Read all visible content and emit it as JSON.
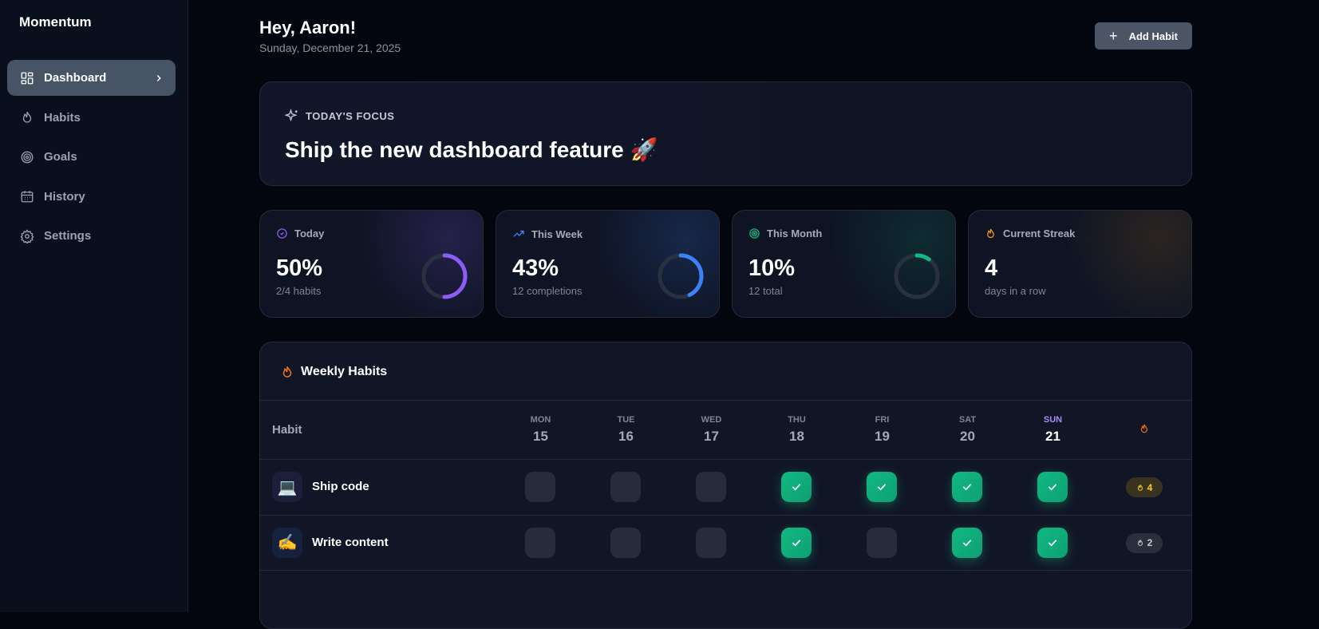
{
  "app": {
    "name": "Momentum"
  },
  "sidebar": {
    "items": [
      {
        "label": "Dashboard",
        "icon": "grid-icon",
        "active": true
      },
      {
        "label": "Habits",
        "icon": "flame-icon"
      },
      {
        "label": "Goals",
        "icon": "target-icon"
      },
      {
        "label": "History",
        "icon": "calendar-icon"
      },
      {
        "label": "Settings",
        "icon": "gear-icon"
      }
    ]
  },
  "header": {
    "greeting": "Hey, Aaron!",
    "date": "Sunday, December 21, 2025",
    "add_label": "Add Habit"
  },
  "focus": {
    "label": "TODAY'S FOCUS",
    "title": "Ship the new dashboard feature 🚀"
  },
  "stats": [
    {
      "label": "Today",
      "value": "50%",
      "sub": "2/4 habits",
      "progress": 0.5,
      "color": "#8b5cf6"
    },
    {
      "label": "This Week",
      "value": "43%",
      "sub": "12 completions",
      "progress": 0.43,
      "color": "#3b82f6"
    },
    {
      "label": "This Month",
      "value": "10%",
      "sub": "12 total",
      "progress": 0.1,
      "color": "#10b981"
    },
    {
      "label": "Current Streak",
      "value": "4",
      "sub": "days in a row",
      "color": "#f59e0b"
    }
  ],
  "weekly": {
    "title": "Weekly Habits",
    "habit_header": "Habit",
    "days": [
      {
        "d": "MON",
        "n": "15"
      },
      {
        "d": "TUE",
        "n": "16"
      },
      {
        "d": "WED",
        "n": "17"
      },
      {
        "d": "THU",
        "n": "18"
      },
      {
        "d": "FRI",
        "n": "19"
      },
      {
        "d": "SAT",
        "n": "20"
      },
      {
        "d": "SUN",
        "n": "21",
        "today": true
      }
    ],
    "habits": [
      {
        "name": "Ship code",
        "emoji": "💻",
        "done": [
          false,
          false,
          false,
          true,
          true,
          true,
          true
        ],
        "streak": "4",
        "hot": true
      },
      {
        "name": "Write content",
        "emoji": "✍️",
        "done": [
          false,
          false,
          false,
          true,
          false,
          true,
          true
        ],
        "streak": "2",
        "hot": false
      }
    ]
  }
}
